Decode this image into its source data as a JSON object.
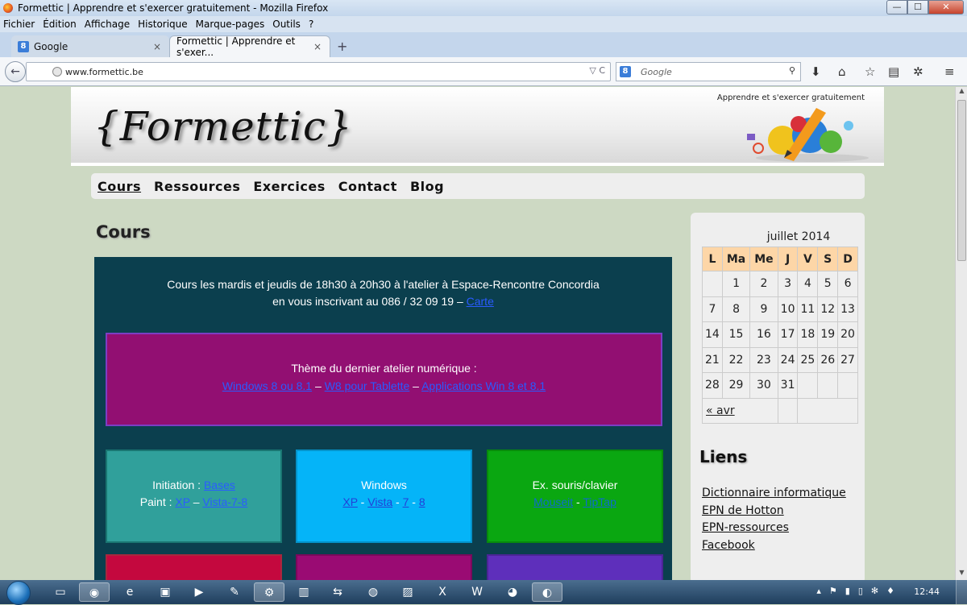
{
  "window": {
    "title": "Formettic | Apprendre et s'exercer gratuitement - Mozilla Firefox",
    "min_label": "—",
    "max_label": "☐",
    "close_label": "✕"
  },
  "menu": [
    "Fichier",
    "Édition",
    "Affichage",
    "Historique",
    "Marque-pages",
    "Outils",
    "?"
  ],
  "tabs": [
    {
      "label": "Google",
      "favicon": "8"
    },
    {
      "label": "Formettic | Apprendre et s'exer...",
      "favicon": ""
    }
  ],
  "tab_close": "×",
  "new_tab": "+",
  "navbar": {
    "back": "←",
    "url": "www.formettic.be",
    "url_controls": "▽  C",
    "search_placeholder": "Google",
    "search_engine_glyph": "8",
    "search_icon_glyph": "⚲",
    "toolbar_icons": [
      {
        "name": "download-icon",
        "glyph": "⬇"
      },
      {
        "name": "home-icon",
        "glyph": "⌂"
      },
      {
        "name": "bookmark-star-icon",
        "glyph": "☆"
      },
      {
        "name": "reading-list-icon",
        "glyph": "▤"
      },
      {
        "name": "settings-gear-icon",
        "glyph": "✲"
      },
      {
        "name": "hamburger-menu-icon",
        "glyph": "≡"
      }
    ]
  },
  "site": {
    "logo": "{Formettic}",
    "tagline": "Apprendre et s'exercer gratuitement",
    "nav": [
      "Cours",
      "Ressources",
      "Exercices",
      "Contact",
      "Blog"
    ],
    "page_title": "Cours",
    "intro_line1": "Cours les mardis et jeudis de 18h30 à 20h30 à l'atelier à Espace-Rencontre Concordia",
    "intro_line2_prefix": "en vous inscrivant au 086 / 32 09 19 – ",
    "intro_link": "Carte",
    "theme": {
      "heading": "Thème du dernier atelier numérique :",
      "links": [
        "Windows 8 ou 8.1",
        "W8 pour Tablette",
        "Applications Win 8 et 8.1"
      ],
      "sep": " – "
    },
    "tiles": [
      {
        "line1_text": "Initiation : ",
        "line1_links": [
          "Bases"
        ],
        "line2_text": "Paint : ",
        "line2_links": [
          "XP",
          "Vista-7-8"
        ],
        "line2_sep": " – "
      },
      {
        "title": "Windows",
        "links": [
          "XP",
          "Vista",
          "7",
          "8"
        ],
        "sep": " - "
      },
      {
        "title": "Ex. souris/clavier",
        "links": [
          "Mouseit",
          "TipTap"
        ],
        "sep": " - "
      }
    ]
  },
  "calendar": {
    "caption": "juillet 2014",
    "headers": [
      "L",
      "Ma",
      "Me",
      "J",
      "V",
      "S",
      "D"
    ],
    "weeks": [
      [
        "",
        "1",
        "2",
        "3",
        "4",
        "5",
        "6"
      ],
      [
        "7",
        "8",
        "9",
        "10",
        "11",
        "12",
        "13"
      ],
      [
        "14",
        "15",
        "16",
        "17",
        "18",
        "19",
        "20"
      ],
      [
        "21",
        "22",
        "23",
        "24",
        "25",
        "26",
        "27"
      ],
      [
        "28",
        "29",
        "30",
        "31",
        "",
        "",
        ""
      ]
    ],
    "prev": "« avr"
  },
  "liens": {
    "title": "Liens",
    "items": [
      "Dictionnaire informatique",
      "EPN de Hotton",
      "EPN-ressources",
      "Facebook"
    ]
  },
  "taskbar": {
    "apps": [
      {
        "name": "explorer-icon",
        "glyph": "▭"
      },
      {
        "name": "firefox-icon",
        "glyph": "◉",
        "active": true
      },
      {
        "name": "internet-explorer-icon",
        "glyph": "e"
      },
      {
        "name": "screen-icon",
        "glyph": "▣"
      },
      {
        "name": "media-player-icon",
        "glyph": "▶"
      },
      {
        "name": "paint-icon",
        "glyph": "✎"
      },
      {
        "name": "tool-icon",
        "glyph": "⚙"
      },
      {
        "name": "notepad-icon",
        "glyph": "▥"
      },
      {
        "name": "transfer-icon",
        "glyph": "⇆"
      },
      {
        "name": "chrome-icon",
        "glyph": "◍"
      },
      {
        "name": "image-viewer-icon",
        "glyph": "▨"
      },
      {
        "name": "excel-icon",
        "glyph": "X"
      },
      {
        "name": "word-icon",
        "glyph": "W"
      },
      {
        "name": "gimp-icon",
        "glyph": "◕"
      },
      {
        "name": "messenger-icon",
        "glyph": "◐"
      }
    ],
    "tray": [
      "▴",
      "⚑",
      "▮",
      "▯",
      "✻",
      "♦"
    ],
    "clock": "12:44"
  }
}
